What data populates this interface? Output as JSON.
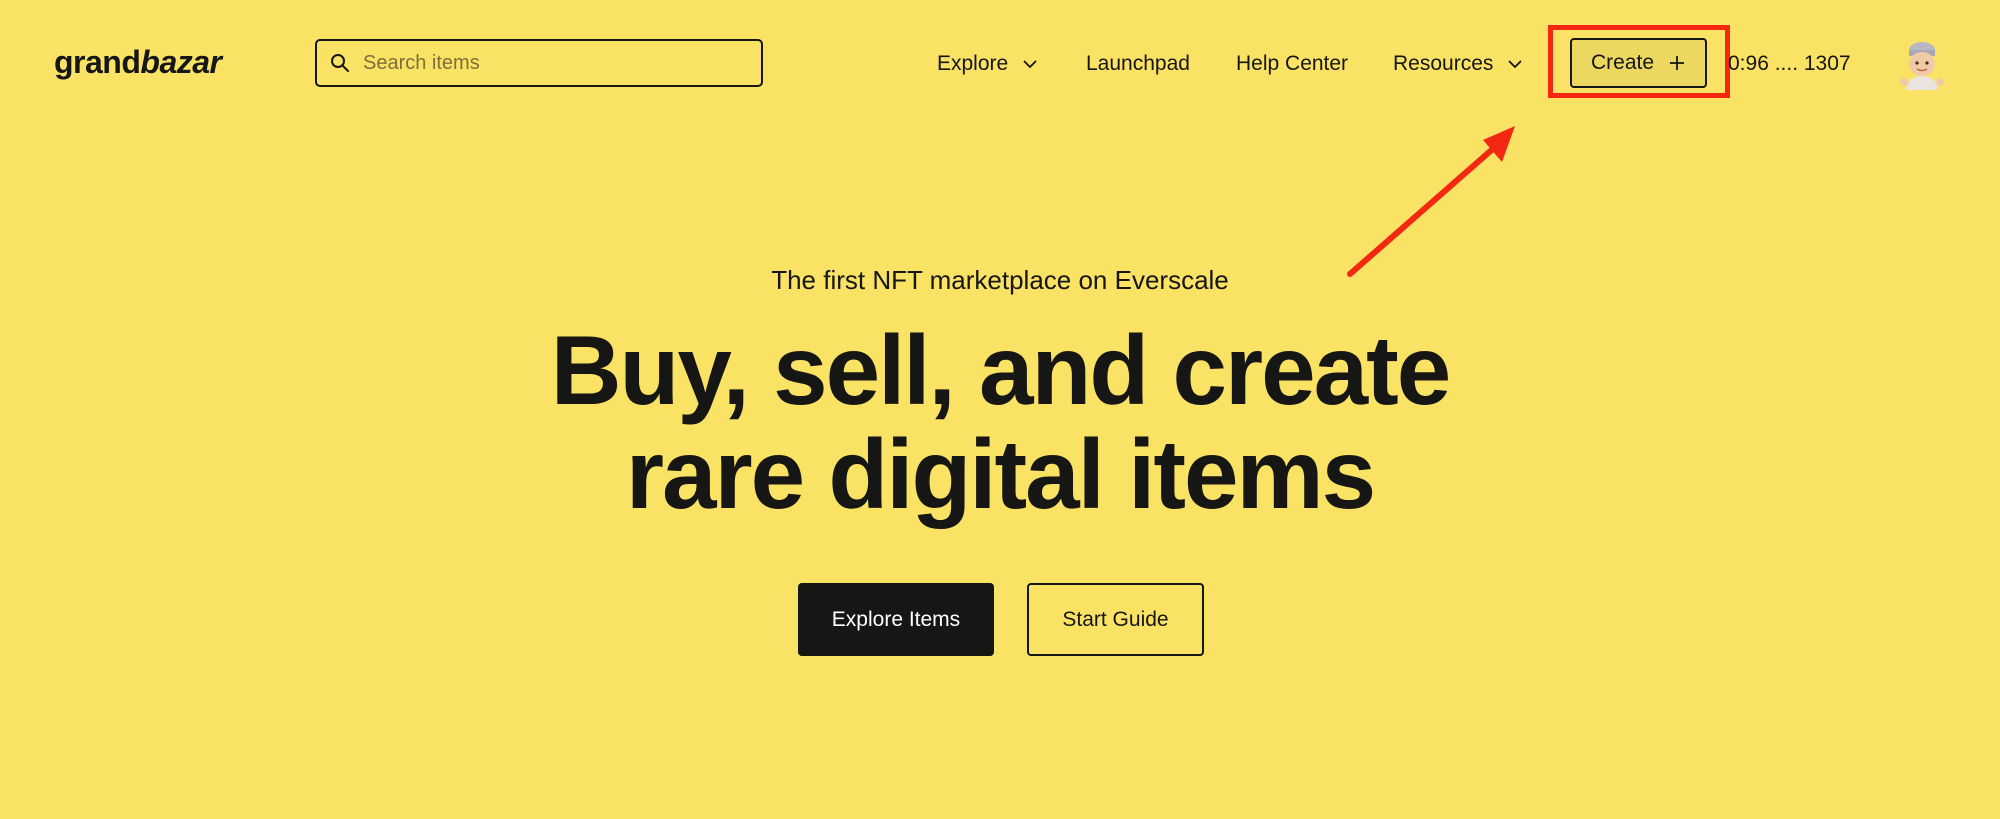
{
  "colors": {
    "background": "#fae264",
    "text": "#161614",
    "primary_button_bg": "#161614",
    "primary_button_text": "#ffffff",
    "create_button_bg": "#ecd760",
    "annotation": "#f42812"
  },
  "header": {
    "logo_part1": "grand",
    "logo_part2": "bazar",
    "search": {
      "placeholder": "Search items",
      "value": "",
      "icon": "search-icon"
    },
    "nav": [
      {
        "label": "Explore",
        "has_dropdown": true
      },
      {
        "label": "Launchpad",
        "has_dropdown": false
      },
      {
        "label": "Help Center",
        "has_dropdown": false
      },
      {
        "label": "Resources",
        "has_dropdown": true
      }
    ],
    "create_label": "Create",
    "create_icon": "plus-icon",
    "wallet_address": "0:96 .... 1307",
    "avatar_icon": "avatar-icon"
  },
  "annotation": {
    "type": "arrow-and-box",
    "target": "create-button"
  },
  "hero": {
    "tagline": "The first NFT marketplace on Everscale",
    "headline_line1": "Buy, sell, and create",
    "headline_line2": "rare digital items",
    "primary_button": "Explore Items",
    "secondary_button": "Start Guide"
  }
}
